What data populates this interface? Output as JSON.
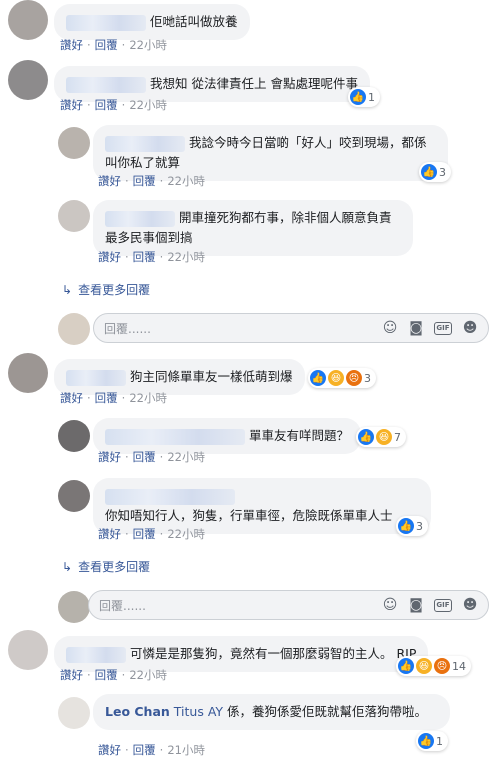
{
  "actions": {
    "like": "讚好",
    "reply": "回覆",
    "sep": "·"
  },
  "comments": [
    {
      "text": "佢哋話叫做放養",
      "time": "22小時"
    },
    {
      "text": "我想知 從法律責任上 會點處理呢件事",
      "time": "22小時",
      "reactions": "1"
    },
    {
      "text": "我諗今時今日當啲「好人」咬到現場，都係叫你私了就算",
      "time": "22小時",
      "reactions": "3"
    },
    {
      "text": "開車撞死狗都冇事，除非個人願意負責最多民事個到搞",
      "time": "22小時"
    },
    {
      "text": "狗主同條單車友一樣低萌到爆",
      "time": "22小時",
      "reactions": "3"
    },
    {
      "text": "單車友有咩問題？",
      "time": "22小時",
      "reactions": "7"
    },
    {
      "text": "你知唔知行人，狗隻，行單車徑，危險既係單車人士",
      "time": "22小時",
      "reactions": "3"
    },
    {
      "text": "可憐是是那隻狗，竟然有一個那麼弱智的主人。 RIP",
      "time": "22小時",
      "reactions": "14"
    },
    {
      "name": "Leo Chan",
      "mention": "Titus AY",
      "text": "係，養狗係愛佢既就幫佢落狗帶啦。",
      "time": "21小時",
      "reactions": "1"
    }
  ],
  "view_more": "查看更多回覆",
  "composer_placeholder": "回覆......",
  "icons": {
    "reply_arrow": "reply-arrow-icon",
    "emoji": "emoji-icon",
    "camera": "camera-icon",
    "gif": "gif-icon",
    "sticker": "sticker-icon"
  },
  "colors": {
    "link": "#385898",
    "like": "#1877f2",
    "bubble": "#f2f3f5"
  }
}
